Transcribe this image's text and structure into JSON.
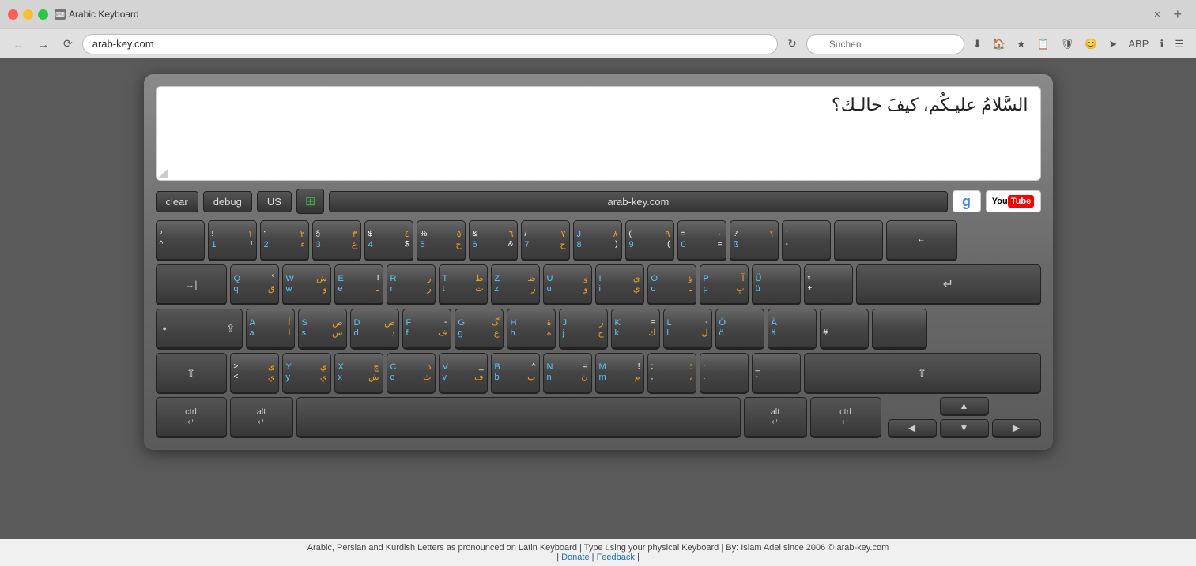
{
  "browser": {
    "title": "Arabic Keyboard",
    "url": "arab-key.com",
    "search_placeholder": "Suchen",
    "new_tab_label": "+"
  },
  "toolbar": {
    "clear_label": "clear",
    "debug_label": "debug",
    "layout_label": "US",
    "url_display": "arab-key.com",
    "google_icon": "g",
    "youtube_you": "You",
    "youtube_tube": "Tube"
  },
  "textarea": {
    "content": "السَّلامُ عليـكُم، كيفَ حالـك؟"
  },
  "keyboard": {
    "row1": [
      {
        "top_left": "°",
        "top_right": "",
        "bot_left": "^",
        "bot_right": "",
        "latin": "",
        "arabic": "",
        "width": "std"
      },
      {
        "top_left": "!",
        "top_right": "١",
        "bot_left": "1",
        "bot_right": "!",
        "latin": "1",
        "arabic": "١",
        "width": "std"
      },
      {
        "top_left": "\"",
        "top_right": "٢",
        "bot_left": "2",
        "bot_right": "ء",
        "latin": "2",
        "arabic": "٢",
        "width": "std"
      },
      {
        "top_left": "§",
        "top_right": "٣",
        "bot_left": "3",
        "bot_right": "ع",
        "latin": "3",
        "arabic": "٣",
        "width": "std"
      },
      {
        "top_left": "$",
        "top_right": "٤",
        "bot_left": "4",
        "bot_right": "$",
        "latin": "4",
        "arabic": "٤",
        "width": "std"
      },
      {
        "top_left": "%",
        "top_right": "٥",
        "bot_left": "5",
        "bot_right": "خ",
        "latin": "5",
        "arabic": "٥",
        "width": "std"
      },
      {
        "top_left": "&",
        "top_right": "٦",
        "bot_left": "6",
        "bot_right": "&",
        "latin": "6",
        "arabic": "٦",
        "width": "std"
      },
      {
        "top_left": "/",
        "top_right": "٧",
        "bot_left": "7",
        "bot_right": "ح",
        "latin": "7",
        "arabic": "٧",
        "width": "std"
      },
      {
        "top_left": "J",
        "top_right": "٨",
        "bot_left": "8",
        "bot_right": ")",
        "latin": "8",
        "arabic": "٨",
        "width": "std"
      },
      {
        "top_left": "(",
        "top_right": "٩",
        "bot_left": "9",
        "bot_right": "(",
        "latin": "9",
        "arabic": "٩",
        "width": "std"
      },
      {
        "top_left": "=",
        "top_right": "٠",
        "bot_left": "0",
        "bot_right": "=",
        "latin": "0",
        "arabic": "٠",
        "width": "std"
      },
      {
        "top_left": "?",
        "top_right": "؟",
        "bot_left": "ß",
        "bot_right": "",
        "latin": "ß",
        "arabic": "",
        "width": "std"
      },
      {
        "top_left": "`",
        "top_right": "",
        "bot_left": "-",
        "bot_right": "",
        "latin": "-",
        "arabic": "",
        "width": "std"
      },
      {
        "top_left": "",
        "top_right": "",
        "bot_left": "",
        "bot_right": "",
        "latin": "",
        "arabic": "",
        "width": "std"
      },
      {
        "top_left": "←",
        "top_right": "",
        "bot_left": "",
        "bot_right": "",
        "latin": "backspace",
        "arabic": "",
        "width": "backspace"
      }
    ],
    "row2": [
      {
        "label": "→|",
        "sublabel": "",
        "width": "wide"
      },
      {
        "top": "Q °",
        "bot": "q ق",
        "width": "std"
      },
      {
        "top": "W ش",
        "bot": "w و",
        "width": "std"
      },
      {
        "top": "E !",
        "bot": "e ـ",
        "width": "std"
      },
      {
        "top": "R ر",
        "bot": "r ر",
        "width": "std"
      },
      {
        "top": "T ط",
        "bot": "t ت",
        "width": "std"
      },
      {
        "top": "Z ظ",
        "bot": "z ز",
        "width": "std"
      },
      {
        "top": "U و",
        "bot": "u و",
        "width": "std"
      },
      {
        "top": "I ى",
        "bot": "i ي",
        "width": "std"
      },
      {
        "top": "O ؤ",
        "bot": "o ـ",
        "width": "std"
      },
      {
        "top": "P آ",
        "bot": "p پ",
        "width": "std"
      },
      {
        "top": "Ü",
        "bot": "ü",
        "width": "std"
      },
      {
        "top": "*",
        "bot": "+",
        "width": "std"
      },
      {
        "label": "↵",
        "width": "enter"
      }
    ],
    "row3": [
      {
        "label": "⇪",
        "width": "capslock"
      },
      {
        "top": "A أ",
        "bot": "a ا",
        "width": "std"
      },
      {
        "top": "S ص",
        "bot": "s س",
        "width": "std"
      },
      {
        "top": "D ض",
        "bot": "d د",
        "width": "std"
      },
      {
        "top": "F -",
        "bot": "f ف",
        "width": "std"
      },
      {
        "top": "G گ",
        "bot": "g غ",
        "width": "std"
      },
      {
        "top": "H ة",
        "bot": "h ه",
        "width": "std"
      },
      {
        "top": "J ز",
        "bot": "j ج",
        "width": "std"
      },
      {
        "top": "K =",
        "bot": "k ك",
        "width": "std"
      },
      {
        "top": "L -",
        "bot": "l ل",
        "width": "std"
      },
      {
        "top": "Ö",
        "bot": "ö",
        "width": "std"
      },
      {
        "top": "Ä",
        "bot": "ä",
        "width": "std"
      },
      {
        "top": "'",
        "bot": "#",
        "width": "std"
      },
      {
        "label": "",
        "width": "std"
      }
    ],
    "row4": [
      {
        "label": "⇧",
        "width": "shift-left"
      },
      {
        "top": "> ى",
        "bot": "< ي",
        "width": "std"
      },
      {
        "top": "Y ي",
        "bot": "y ي",
        "width": "std"
      },
      {
        "top": "X چ",
        "bot": "x ش",
        "width": "std"
      },
      {
        "top": "C ذ",
        "bot": "c ث",
        "width": "std"
      },
      {
        "top": "V ـ",
        "bot": "v ف",
        "width": "std"
      },
      {
        "top": "B ^",
        "bot": "b ب",
        "width": "std"
      },
      {
        "top": "N =",
        "bot": "n ن",
        "width": "std"
      },
      {
        "top": "M !",
        "bot": "m م",
        "width": "std"
      },
      {
        "top": "; ؛",
        "bot": ", ،",
        "width": "std"
      },
      {
        "top": ":",
        "bot": ".",
        "width": "std"
      },
      {
        "top": "_",
        "bot": "-",
        "width": "std"
      },
      {
        "label": "⇧",
        "width": "shift-right"
      }
    ],
    "row5": [
      {
        "label": "ctrl\n↵",
        "width": "ctrl"
      },
      {
        "label": "alt\n↵",
        "width": "alt"
      },
      {
        "label": "",
        "width": "space"
      },
      {
        "label": "alt\n↵",
        "width": "alt"
      },
      {
        "label": "ctrl\n↵",
        "width": "ctrl"
      },
      {
        "label": "◀",
        "width": "arrow"
      },
      {
        "label": "▲\n▼",
        "width": "arrow-updown"
      },
      {
        "label": "▶",
        "width": "arrow"
      }
    ]
  },
  "footer": {
    "text": "Arabic, Persian and Kurdish Letters as pronounced on Latin Keyboard | Type using your physical Keyboard | By: Islam Adel since 2006 © arab-key.com",
    "donate": "Donate",
    "feedback": "Feedback"
  }
}
